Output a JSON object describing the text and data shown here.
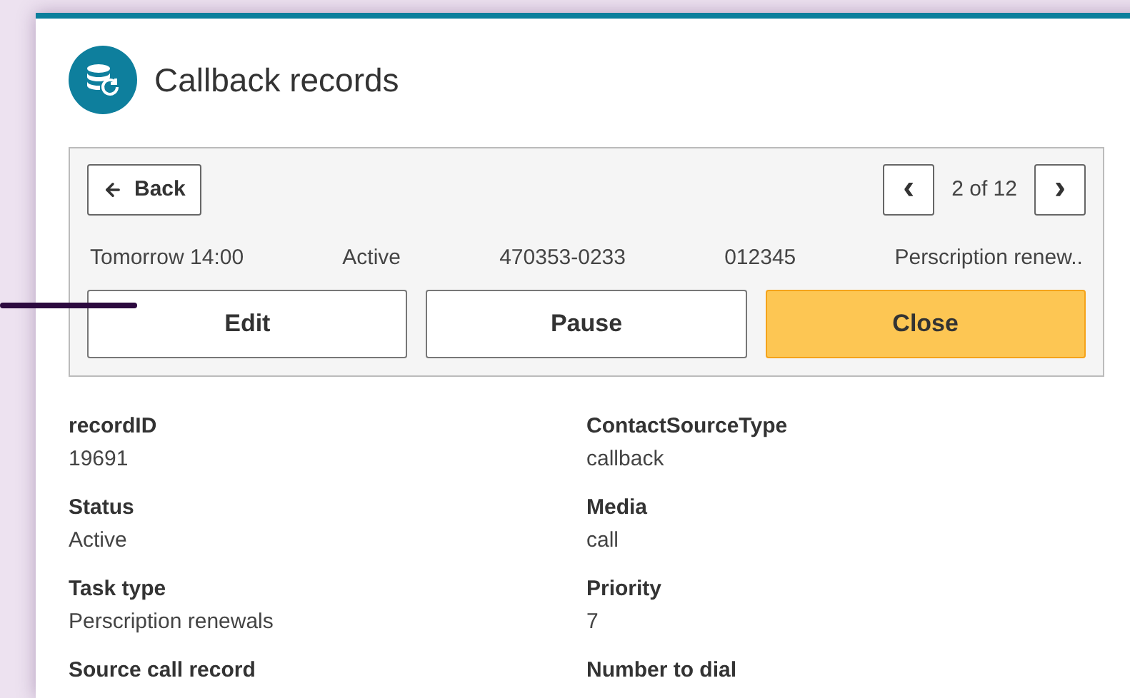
{
  "window": {
    "title": "Callback records"
  },
  "navigation": {
    "back": "Back",
    "prev": "‹",
    "position": "2 of 12",
    "next": "›"
  },
  "summary": [
    "Tomorrow 14:00",
    "Active",
    "470353-0233",
    "012345",
    "Perscription renew.."
  ],
  "actions": [
    {
      "label": "Edit",
      "kind": "default"
    },
    {
      "label": "Pause",
      "kind": "default"
    },
    {
      "label": "Close",
      "kind": "primary"
    }
  ],
  "fields": [
    {
      "label": "recordID",
      "value": "19691"
    },
    {
      "label": "ContactSourceType",
      "value": "callback"
    },
    {
      "label": "Status",
      "value": "Active"
    },
    {
      "label": "Media",
      "value": "call"
    },
    {
      "label": "Task type",
      "value": "Perscription renewals"
    },
    {
      "label": "Priority",
      "value": "7"
    },
    {
      "label": "Source call record"
    },
    {
      "label": "Number to dial"
    }
  ]
}
